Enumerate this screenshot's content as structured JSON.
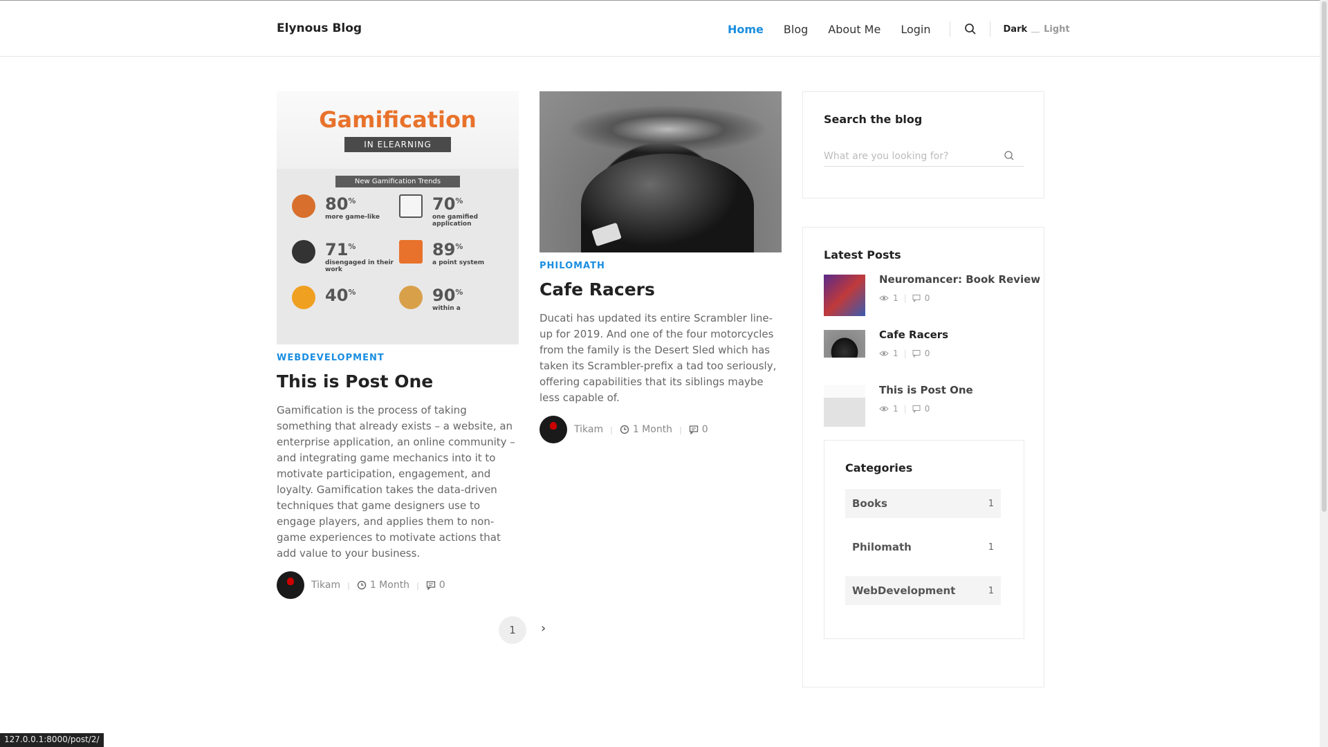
{
  "header": {
    "logo": "Elynous Blog",
    "nav": [
      "Home",
      "Blog",
      "About Me",
      "Login"
    ],
    "theme_dark": "Dark",
    "theme_light": "Light"
  },
  "posts": [
    {
      "category": "WEBDEVELOPMENT",
      "title": "This is Post One",
      "excerpt": "Gamification is the process of taking something that already exists – a website, an enterprise application, an online community – and integrating game mechanics into it to motivate participation, engagement, and loyalty. Gamification takes the data-driven techniques that game designers use to engage players, and applies them to non-game experiences to motivate actions that add value to your business.",
      "author": "Tikam",
      "time": "1 Month",
      "comments": "0",
      "image": {
        "title": "Gamification",
        "ribbon": "IN ELEARNING",
        "trends": "New Gamification Trends",
        "stats": [
          {
            "num": "80",
            "sup": "%",
            "text": "more game-like"
          },
          {
            "num": "70",
            "sup": "%",
            "text": "one gamified application"
          },
          {
            "num": "71",
            "sup": "%",
            "text": "disengaged in their work"
          },
          {
            "num": "89",
            "sup": "%",
            "text": "a point system"
          },
          {
            "num": "40",
            "sup": "%",
            "text": ""
          },
          {
            "num": "90",
            "sup": "%",
            "text": "within a"
          }
        ]
      }
    },
    {
      "category": "PHILOMATH",
      "title": "Cafe Racers",
      "excerpt": "Ducati has updated its entire Scrambler line-up for 2019. And one of the four motorcycles from the family is the Desert Sled which has taken its Scrambler-prefix a tad too seriously, offering capabilities that its siblings maybe less capable of.",
      "author": "Tikam",
      "time": "1 Month",
      "comments": "0"
    }
  ],
  "pagination": {
    "current": "1",
    "next": "›"
  },
  "sidebar": {
    "search_title": "Search the blog",
    "search_placeholder": "What are you looking for?",
    "latest_title": "Latest Posts",
    "latest": [
      {
        "title": "Neuromancer: Book Review",
        "views": "1",
        "comments": "0"
      },
      {
        "title": "Cafe Racers",
        "views": "1",
        "comments": "0"
      },
      {
        "title": "This is Post One",
        "views": "1",
        "comments": "0"
      }
    ],
    "categories_title": "Categories",
    "categories": [
      {
        "name": "Books",
        "count": "1"
      },
      {
        "name": "Philomath",
        "count": "1"
      },
      {
        "name": "WebDevelopment",
        "count": "1"
      }
    ]
  },
  "status_bar": "127.0.0.1:8000/post/2/",
  "colors": {
    "accent": "#1a8ee0",
    "brand_orange": "#e8722b"
  }
}
